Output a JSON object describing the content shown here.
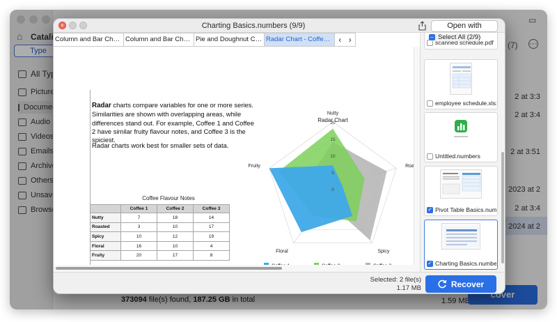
{
  "background_app": {
    "sidebar_title": "Catalin",
    "type_tab": "Type",
    "sidebar_items": [
      {
        "label": "All Type",
        "icon": "grid-icon"
      },
      {
        "label": "Pictures",
        "icon": "image-icon"
      },
      {
        "label": "Documents",
        "icon": "document-icon"
      },
      {
        "label": "Audio",
        "icon": "music-icon"
      },
      {
        "label": "Videos",
        "icon": "video-icon"
      },
      {
        "label": "Emails",
        "icon": "mail-icon"
      },
      {
        "label": "Archives",
        "icon": "archive-icon"
      },
      {
        "label": "Others",
        "icon": "folder-icon"
      },
      {
        "label": "Unsaved",
        "icon": "file-icon"
      },
      {
        "label": "Browser",
        "icon": "bookmark-icon"
      }
    ],
    "count_label": "(7)",
    "right_cells": [
      "2 at 3:3",
      "2 at 3:4",
      "2 at 3:51",
      "2023 at 2",
      "2 at 3:4",
      "2024 at 2"
    ],
    "footer_count": "373094",
    "footer_suffix": " file(s) found, ",
    "footer_size": "187.25 GB",
    "footer_tail": " in total",
    "footer_size_right": "1.59 MB",
    "recover_label": "cover"
  },
  "preview": {
    "title": "Charting Basics.numbers (9/9)",
    "open_button": "Open with Numbers",
    "sheet_tabs": [
      "Column and Bar Charts - Sales",
      "Column and Bar Charts - Revenue",
      "Pie and Doughnut Charts",
      "Radar Chart - Coffee Flavours"
    ],
    "active_tab_index": 3,
    "text_lead_bold": "Radar",
    "text_lead_rest": " charts compare variables for one or more series. Similarities are shown with overlapping areas, while differences stand out. For example, Coffee 1 and Coffee 2 have similar fruity flavour notes, and Coffee 3 is the spiciest.",
    "text_second": "Radar charts work best for smaller sets of data.",
    "table": {
      "title": "Coffee Flavour Notes",
      "columns": [
        "Coffee 1",
        "Coffee 2",
        "Coffee 3"
      ],
      "rows": [
        {
          "label": "Nutty",
          "values": [
            7,
            18,
            14
          ]
        },
        {
          "label": "Roasted",
          "values": [
            3,
            10,
            17
          ]
        },
        {
          "label": "Spicy",
          "values": [
            10,
            12,
            19
          ]
        },
        {
          "label": "Floral",
          "values": [
            16,
            10,
            4
          ]
        },
        {
          "label": "Fruity",
          "values": [
            20,
            17,
            8
          ]
        }
      ]
    },
    "thumbnails": {
      "select_all": "Select All (2/9)",
      "items": [
        {
          "label": "scanned schedule.pdf",
          "checked": false
        },
        {
          "label": "employee schedule.xlsx",
          "checked": false
        },
        {
          "label": "Untitled.numbers",
          "checked": false
        },
        {
          "label": "Pivot Table Basics.numbers",
          "checked": true
        },
        {
          "label": "Charting Basics.numbers",
          "checked": true
        }
      ]
    },
    "footer": {
      "selected": "Selected: 2 file(s)",
      "size": "1.17 MB",
      "recover_button": "Recover"
    }
  },
  "chart_data": {
    "type": "radar",
    "title": "Radar Chart",
    "axes": [
      "Nutty",
      "Roasted",
      "Spicy",
      "Floral",
      "Fruity"
    ],
    "axis_ticks": [
      0,
      5,
      10,
      15,
      20
    ],
    "range": [
      0,
      20
    ],
    "series": [
      {
        "name": "Coffee 1",
        "values": [
          7,
          3,
          10,
          16,
          20
        ],
        "color": "#3fa9e8"
      },
      {
        "name": "Coffee 2",
        "values": [
          18,
          10,
          12,
          10,
          17
        ],
        "color": "#7ed05b"
      },
      {
        "name": "Coffee 3",
        "values": [
          14,
          17,
          19,
          4,
          8
        ],
        "color": "#b3b3b3"
      }
    ],
    "legend_position": "bottom"
  }
}
